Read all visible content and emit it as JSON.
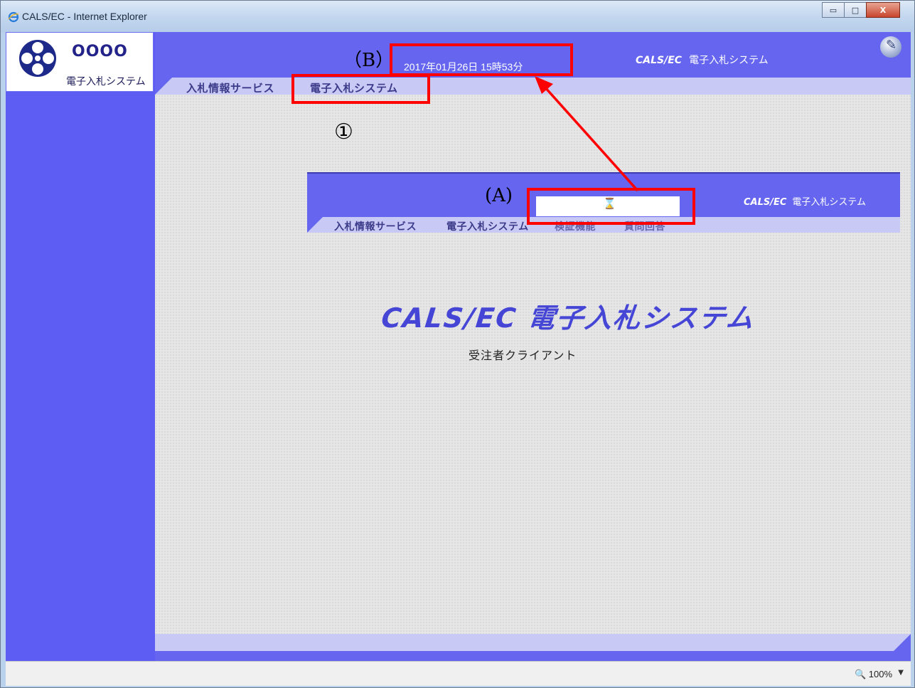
{
  "window": {
    "title": "CALS/EC - Internet Explorer",
    "controls": {
      "minimize": "▭",
      "maximize": "□",
      "close": "X"
    }
  },
  "logo": {
    "name": "OOOO",
    "subtitle": "電子入札システム"
  },
  "header": {
    "datetime": "2017年01月26日 15時53分",
    "brand_latin": "CALS/EC",
    "brand_jp": "電子入札システム",
    "nav": [
      "入札情報サービス",
      "電子入札システム"
    ]
  },
  "inset": {
    "brand_latin": "CALS/EC",
    "brand_jp": "電子入札システム",
    "busy_icon": "hourglass-icon",
    "nav": [
      "入札情報サービス",
      "電子入札システム",
      "検証機能",
      "質問回答"
    ]
  },
  "main": {
    "title": "CALS/EC 電子入札システム",
    "subtitle": "受注者クライアント"
  },
  "annotations": {
    "label_b": "（B）",
    "label_a": "(A)",
    "label_1": "①",
    "color": "#ff0000"
  },
  "status": {
    "zoom": "100%"
  },
  "colors": {
    "header_blue": "#6565ef",
    "nav_strip": "#c9c9f6",
    "annotation_red": "#ff0000"
  }
}
